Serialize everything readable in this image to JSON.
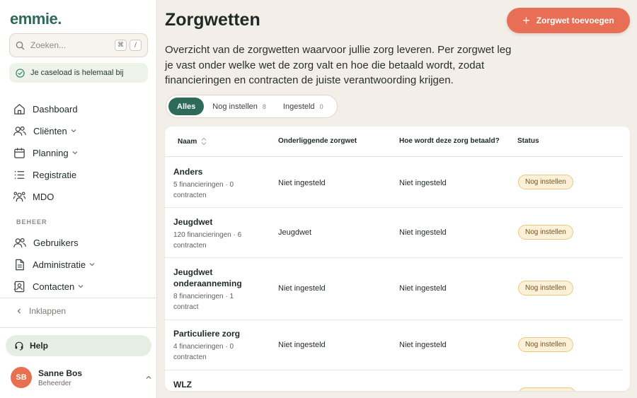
{
  "sidebar": {
    "logo": "emmie.",
    "search": {
      "placeholder": "Zoeken...",
      "shortcut_1": "⌘",
      "shortcut_2": "/"
    },
    "caseload_status": "Je caseload is helemaal bij",
    "nav": [
      {
        "label": "Dashboard",
        "icon": "home-icon"
      },
      {
        "label": "Cliënten",
        "icon": "users-icon",
        "expandable": true
      },
      {
        "label": "Planning",
        "icon": "calendar-icon",
        "expandable": true
      },
      {
        "label": "Registratie",
        "icon": "list-icon"
      },
      {
        "label": "MDO",
        "icon": "group-icon"
      }
    ],
    "section_beheer": "BEHEER",
    "beheer": [
      {
        "label": "Gebruikers",
        "icon": "users-icon"
      },
      {
        "label": "Administratie",
        "icon": "document-icon",
        "expandable": true
      },
      {
        "label": "Contacten",
        "icon": "contacts-icon",
        "expandable": true
      }
    ],
    "collapse_label": "Inklappen",
    "help_label": "Help",
    "user": {
      "initials": "SB",
      "name": "Sanne Bos",
      "role": "Beheerder"
    }
  },
  "main": {
    "title": "Zorgwetten",
    "add_button": "Zorgwet toevoegen",
    "description": "Overzicht van de zorgwetten waarvoor jullie zorg leveren. Per zorgwet leg je vast onder welke wet de zorg valt en hoe die betaald wordt, zodat financieringen en contracten de juiste verantwoording krijgen.",
    "tabs": [
      {
        "label": "Alles",
        "count": "",
        "active": true
      },
      {
        "label": "Nog instellen",
        "count": "8"
      },
      {
        "label": "Ingesteld",
        "count": "0"
      }
    ],
    "table": {
      "headers": [
        "Naam",
        "Onderliggende zorgwet",
        "Hoe wordt deze zorg betaald?",
        "Status"
      ],
      "rows": [
        {
          "name": "Anders",
          "sub": "5 financieringen · 0 contracten",
          "zorgwet": "Niet ingesteld",
          "betaald": "Niet ingesteld",
          "status": "Nog instellen"
        },
        {
          "name": "Jeugdwet",
          "sub": "120 financieringen · 6 contracten",
          "zorgwet": "Jeugdwet",
          "betaald": "Niet ingesteld",
          "status": "Nog instellen"
        },
        {
          "name": "Jeugdwet onderaanneming",
          "sub": "8 financieringen · 1 contract",
          "zorgwet": "Niet ingesteld",
          "betaald": "Niet ingesteld",
          "status": "Nog instellen"
        },
        {
          "name": "Particuliere zorg",
          "sub": "4 financieringen · 0 contracten",
          "zorgwet": "Niet ingesteld",
          "betaald": "Niet ingesteld",
          "status": "Nog instellen"
        },
        {
          "name": "WLZ",
          "sub": "",
          "zorgwet": "",
          "betaald": "",
          "status": ""
        }
      ]
    }
  },
  "colors": {
    "brand_green": "#2d6a57",
    "accent_orange": "#e86f55",
    "badge_bg": "#fbf1d8"
  }
}
